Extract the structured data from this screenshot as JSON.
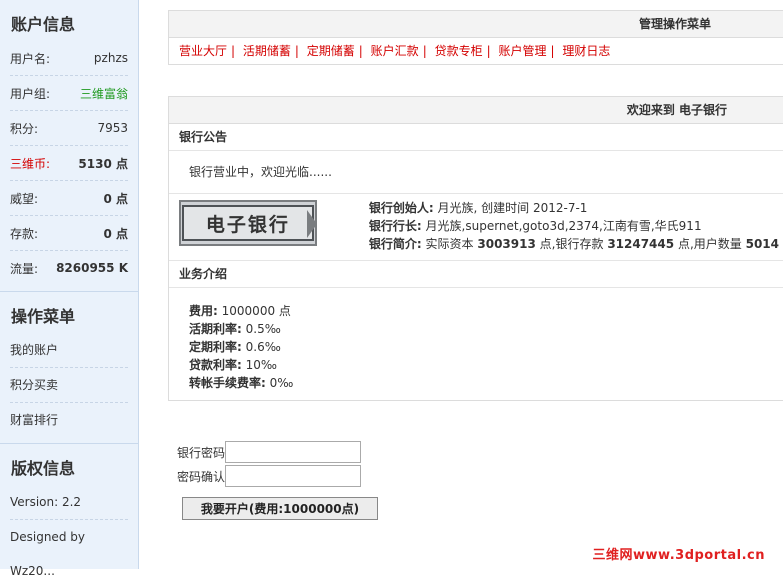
{
  "sidebar": {
    "account_title": "账户信息",
    "rows": [
      {
        "label": "用户名:",
        "value": "pzhzs"
      },
      {
        "label": "用户组:",
        "value": "三维富翁"
      },
      {
        "label": "积分:",
        "value": "7953"
      },
      {
        "label": "三维币:",
        "value": "5130 点"
      },
      {
        "label": "威望:",
        "value": "0 点"
      },
      {
        "label": "存款:",
        "value": "0 点"
      },
      {
        "label": "流量:",
        "value": "8260955 K"
      }
    ],
    "menu_title": "操作菜单",
    "menu_items": [
      "我的账户",
      "积分买卖",
      "财富排行"
    ],
    "copyright_title": "版权信息",
    "version": "Version: 2.2",
    "designer": "Designed by Wz20..."
  },
  "manage_menu": {
    "title": "管理操作菜单",
    "nav": [
      "营业大厅",
      "活期储蓄",
      "定期储蓄",
      "账户汇款",
      "贷款专柜",
      "账户管理",
      "理财日志"
    ]
  },
  "welcome": {
    "title": "欢迎来到 电子银行",
    "notice_heading": "银行公告",
    "notice_text": "银行营业中，欢迎光临......",
    "logo_text": "电子银行",
    "founder_label": "银行创始人:",
    "founder_value": "月光族, 创建时间 2012-7-1",
    "president_label": "银行行长:",
    "president_value": "月光族,supernet,goto3d,2374,江南有雪,华氏911",
    "profile_label": "银行简介:",
    "profile_prefix": "实际资本",
    "capital": "3003913",
    "profile_mid": "点,银行存款",
    "deposits": "31247445",
    "profile_suffix": "点,用户数量",
    "users": "5014",
    "business_heading": "业务介绍",
    "business": [
      {
        "label": "费用:",
        "value": "1000000 点"
      },
      {
        "label": "活期利率:",
        "value": "0.5‰"
      },
      {
        "label": "定期利率:",
        "value": "0.6‰"
      },
      {
        "label": "贷款利率:",
        "value": "10‰"
      },
      {
        "label": "转帐手续费率:",
        "value": "0‰"
      }
    ]
  },
  "form": {
    "password_label": "银行密码",
    "confirm_label": "密码确认",
    "submit_label": "我要开户(费用:1000000点)"
  },
  "watermark": "三维网www.3dportal.cn"
}
